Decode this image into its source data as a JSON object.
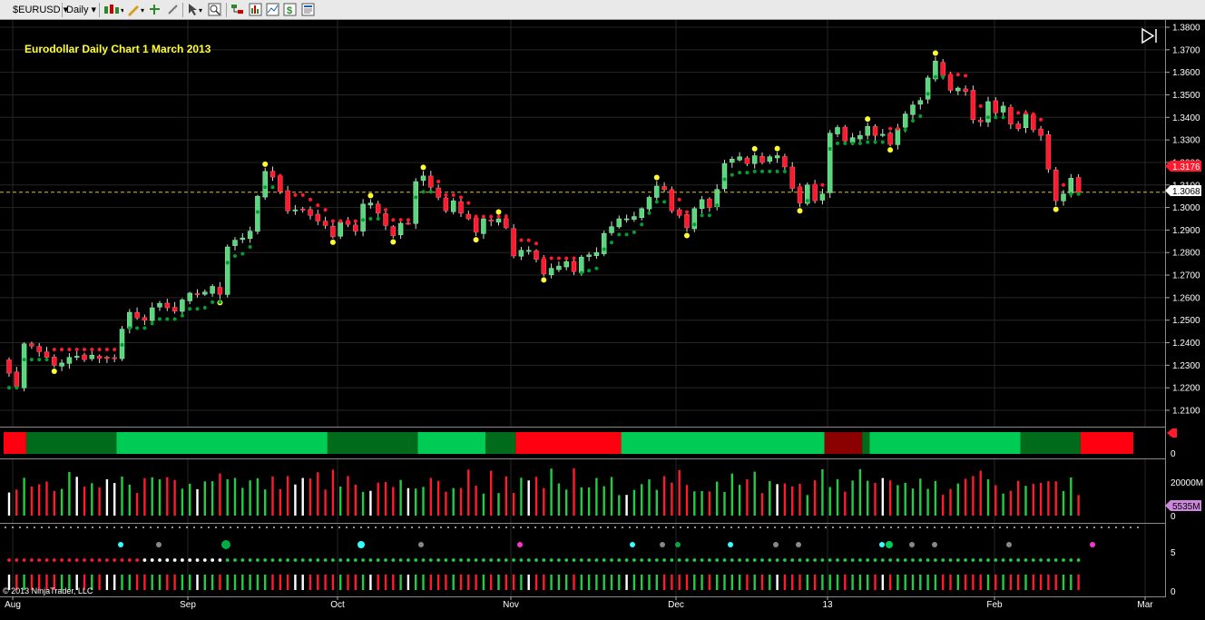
{
  "toolbar": {
    "instrument": "$EURUSD",
    "period": "Daily",
    "tools": [
      "bar-style-icon",
      "pencil-icon",
      "crosshair-icon",
      "magnet-icon",
      "pointer-icon",
      "zoom-icon",
      "strategy-icon",
      "indicators-icon",
      "chart-icon",
      "dollar-icon",
      "properties-icon"
    ]
  },
  "chart": {
    "title": "Eurodollar Daily Chart 1 March 2013",
    "copyright": "© 2013 NinjaTrader, LLC",
    "colors": {
      "up": "#5cd67e",
      "down": "#ff1a2e",
      "yellow": "#ffff33",
      "dark_green": "#006b1a",
      "bright_green": "#00cc55",
      "white": "#ffffff",
      "magenta": "#ff33cc",
      "cyan": "#33ffff",
      "grid": "#2a2a2a"
    }
  },
  "chart_data": {
    "type": "candlestick",
    "instrument": "$EURUSD",
    "period": "Daily",
    "price_axis": {
      "ticks": [
        "1.3800",
        "1.3700",
        "1.3600",
        "1.3500",
        "1.3400",
        "1.3300",
        "1.3200",
        "1.3100",
        "1.3000",
        "1.2900",
        "1.2800",
        "1.2700",
        "1.2600",
        "1.2500",
        "1.2400",
        "1.2300",
        "1.2200",
        "1.2100"
      ],
      "ylim": [
        1.206,
        1.381
      ],
      "current_price_label": "1.3068",
      "marker_price_label": "1.3176",
      "horizontal_line": 1.3068
    },
    "x_labels": [
      "Aug",
      "Sep",
      "Oct",
      "Nov",
      "Dec",
      "13",
      "Feb",
      "Mar"
    ],
    "closes": [
      1.2265,
      1.2205,
      1.2395,
      1.2385,
      1.236,
      1.2335,
      1.23,
      1.231,
      1.2335,
      1.234,
      1.2325,
      1.2345,
      1.233,
      1.233,
      1.233,
      1.246,
      1.2535,
      1.251,
      1.25,
      1.2555,
      1.2575,
      1.2555,
      1.254,
      1.259,
      1.262,
      1.2615,
      1.2625,
      1.265,
      1.2615,
      1.2825,
      1.2855,
      1.2865,
      1.2895,
      1.305,
      1.316,
      1.3135,
      1.307,
      1.2985,
      1.299,
      1.299,
      1.2965,
      1.294,
      1.292,
      1.287,
      1.2935,
      1.2925,
      1.2895,
      1.3015,
      1.302,
      1.2975,
      1.292,
      1.2875,
      1.293,
      1.293,
      1.3115,
      1.314,
      1.309,
      1.3045,
      1.2985,
      1.303,
      1.2975,
      1.295,
      1.289,
      1.295,
      1.294,
      1.295,
      1.291,
      1.2785,
      1.281,
      1.281,
      1.277,
      1.2705,
      1.273,
      1.274,
      1.276,
      1.2715,
      1.278,
      1.279,
      1.28,
      1.2885,
      1.2915,
      1.295,
      1.295,
      1.296,
      1.2995,
      1.3045,
      1.3095,
      1.308,
      1.2985,
      1.2965,
      1.291,
      1.2995,
      1.3035,
      1.3,
      1.308,
      1.3195,
      1.3215,
      1.3225,
      1.3195,
      1.323,
      1.32,
      1.3225,
      1.323,
      1.318,
      1.3085,
      1.302,
      1.31,
      1.303,
      1.306,
      1.333,
      1.3355,
      1.3295,
      1.331,
      1.332,
      1.336,
      1.332,
      1.3325,
      1.328,
      1.335,
      1.3415,
      1.3455,
      1.3475,
      1.3575,
      1.365,
      1.3585,
      1.352,
      1.353,
      1.3515,
      1.339,
      1.338,
      1.347,
      1.342,
      1.345,
      1.337,
      1.335,
      1.3415,
      1.3345,
      1.332,
      1.317,
      1.303,
      1.306,
      1.313,
      1.3068
    ]
  },
  "indicator_bar": {
    "zero_label": "0",
    "segments": [
      {
        "color": "red",
        "bars": 3
      },
      {
        "color": "dark_green",
        "bars": 12
      },
      {
        "color": "bright_green",
        "bars": 28
      },
      {
        "color": "dark_green",
        "bars": 12
      },
      {
        "color": "bright_green",
        "bars": 9
      },
      {
        "color": "dark_green",
        "bars": 4
      },
      {
        "color": "red",
        "bars": 14
      },
      {
        "color": "bright_green",
        "bars": 27
      },
      {
        "color": "dark_red",
        "bars": 5
      },
      {
        "color": "dark_green",
        "bars": 1
      },
      {
        "color": "bright_green",
        "bars": 20
      },
      {
        "color": "dark_green",
        "bars": 8
      },
      {
        "color": "red",
        "bars": 7
      }
    ]
  },
  "volume_panel": {
    "ticks": [
      "20000M",
      "0"
    ],
    "current_label": "5535M"
  },
  "lower_panel": {
    "ticks": [
      "5",
      "0"
    ]
  }
}
